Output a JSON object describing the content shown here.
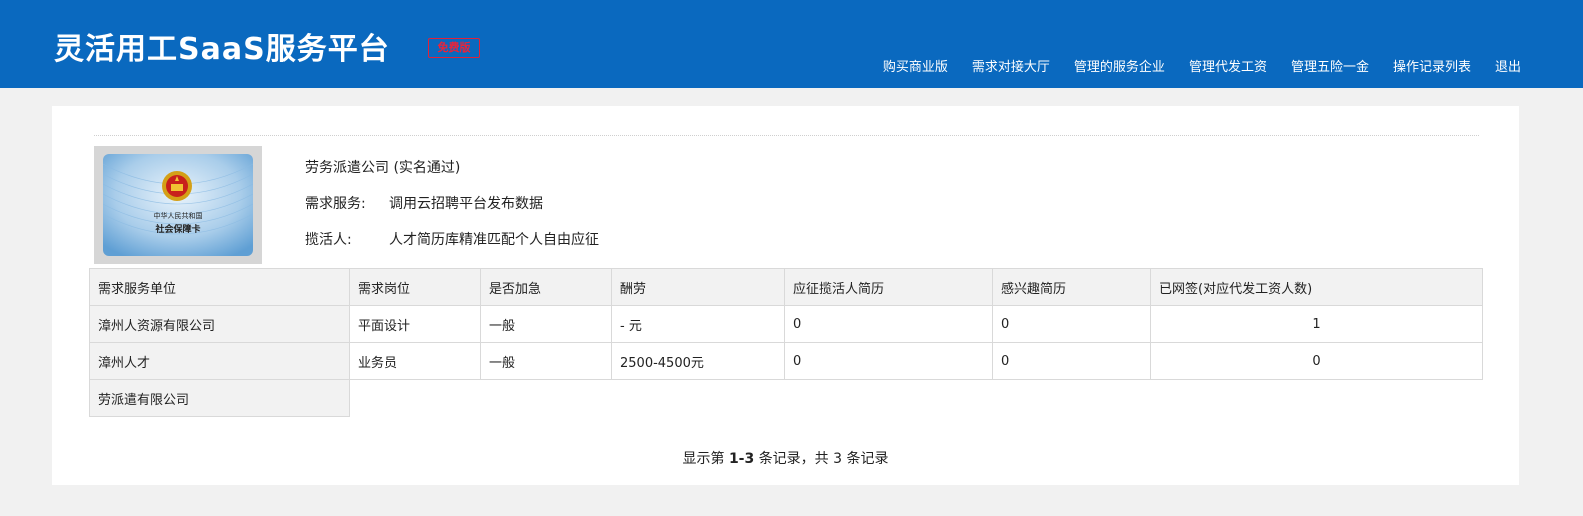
{
  "app": {
    "title": "灵活用工SaaS服务平台",
    "edition_badge": "免费版"
  },
  "nav": {
    "items": [
      {
        "label": "购买商业版"
      },
      {
        "label": "需求对接大厅"
      },
      {
        "label": "管理的服务企业"
      },
      {
        "label": "管理代发工资"
      },
      {
        "label": "管理五险一金"
      },
      {
        "label": "操作记录列表"
      },
      {
        "label": "退出"
      }
    ]
  },
  "card_image": {
    "icon": "social-security-card",
    "line1": "中华人民共和国",
    "line2": "社会保障卡"
  },
  "company": {
    "name": "劳务派遣公司 (实名通过)",
    "service_label": "需求服务:",
    "service_value": "调用云招聘平台发布数据",
    "canvasser_label": "揽活人:",
    "canvasser_value": "人才简历库精准匹配个人自由应征"
  },
  "table": {
    "headers": [
      "需求服务单位",
      "需求岗位",
      "是否加急",
      "酬劳",
      "应征揽活人简历",
      "感兴趣简历",
      "已网签(对应代发工资人数)"
    ],
    "rows": [
      [
        "漳州人资源有限公司",
        "平面设计",
        "一般",
        "- 元",
        "0",
        "0",
        "1"
      ],
      [
        "漳州人才",
        "业务员",
        "一般",
        "2500-4500元",
        "0",
        "0",
        "0"
      ],
      [
        "劳派遣有限公司"
      ]
    ]
  },
  "pager": {
    "prefix": "显示第",
    "range": "1-3",
    "middle": "条记录，共",
    "total": "3",
    "suffix": "条记录"
  },
  "colors": {
    "header_bg": "#0a69bf",
    "badge_red": "#e8243b"
  }
}
